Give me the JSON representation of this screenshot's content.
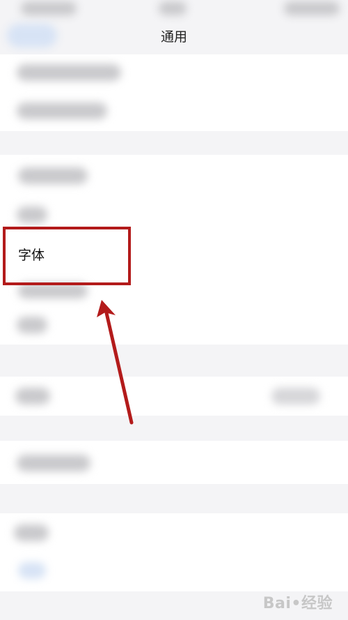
{
  "header": {
    "title": "通用"
  },
  "settings": {
    "items": [
      {
        "label": "字体"
      }
    ]
  },
  "colors": {
    "highlight": "#b31b1b",
    "background": "#f4f4f6",
    "card": "#ffffff"
  },
  "annotation": {
    "arrow_icon": "red-arrow-pointing-up"
  }
}
